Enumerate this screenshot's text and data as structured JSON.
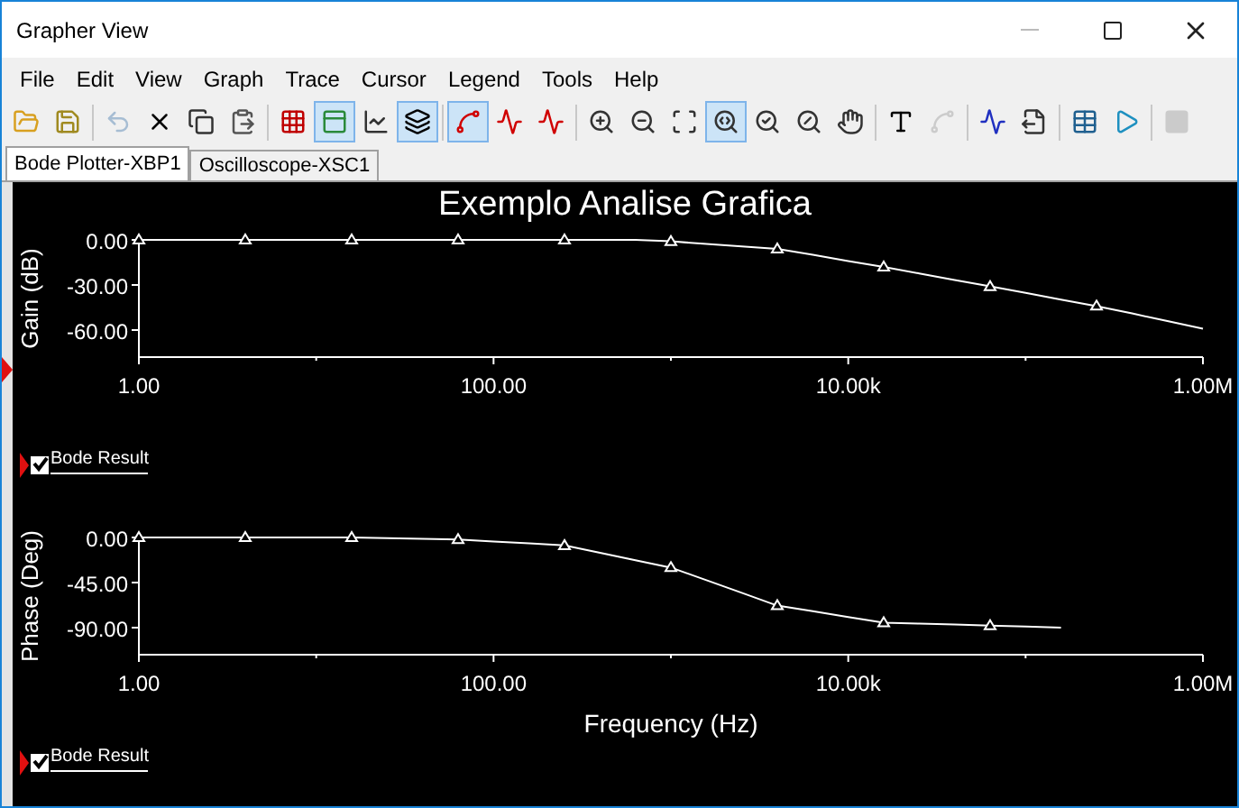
{
  "window": {
    "title": "Grapher View"
  },
  "menu": [
    "File",
    "Edit",
    "View",
    "Graph",
    "Trace",
    "Cursor",
    "Legend",
    "Tools",
    "Help"
  ],
  "toolbar": [
    [
      {
        "selected": false,
        "disabled": false
      },
      {
        "selected": false,
        "disabled": false
      }
    ],
    [
      {
        "selected": false,
        "disabled": true
      },
      {
        "selected": false,
        "disabled": false
      },
      {
        "selected": false,
        "disabled": false
      },
      {
        "selected": false,
        "disabled": false
      }
    ],
    [
      {
        "selected": false,
        "disabled": false
      },
      {
        "selected": true,
        "disabled": false
      },
      {
        "selected": false,
        "disabled": false
      },
      {
        "selected": true,
        "disabled": false
      }
    ],
    [
      {
        "selected": true,
        "disabled": false
      },
      {
        "selected": false,
        "disabled": false
      },
      {
        "selected": false,
        "disabled": false
      }
    ],
    [
      {
        "selected": false,
        "disabled": false
      },
      {
        "selected": false,
        "disabled": false
      },
      {
        "selected": false,
        "disabled": false
      },
      {
        "selected": true,
        "disabled": false
      },
      {
        "selected": false,
        "disabled": false
      },
      {
        "selected": false,
        "disabled": false
      },
      {
        "selected": false,
        "disabled": false
      }
    ],
    [
      {
        "selected": false,
        "disabled": false
      },
      {
        "selected": false,
        "disabled": true
      }
    ],
    [
      {
        "selected": false,
        "disabled": false
      },
      {
        "selected": false,
        "disabled": false
      }
    ],
    [
      {
        "selected": false,
        "disabled": false
      },
      {
        "selected": false,
        "disabled": false
      }
    ],
    [
      {
        "selected": false,
        "disabled": true
      }
    ]
  ],
  "tabs": [
    {
      "label": "Bode Plotter-XBP1",
      "selected": true
    },
    {
      "label": "Oscilloscope-XSC1",
      "selected": false
    }
  ],
  "graphs": [
    {
      "legend": {
        "checked": true
      },
      "chart_data": {
        "type": "line",
        "title": "Exemplo Analise Grafica",
        "ylabel": "Gain (dB)",
        "ylim": [
          -78,
          0
        ],
        "categories": [
          "1.00",
          null,
          null,
          null,
          null,
          null,
          null,
          null,
          null,
          null,
          "100.00",
          null,
          null,
          null,
          null,
          null,
          null,
          null,
          null,
          null,
          "10.00k",
          null,
          null,
          null,
          null,
          null,
          null,
          null,
          null,
          null,
          "1.00M"
        ],
        "yticks": [
          {
            "value": 0,
            "label": "0.00"
          },
          {
            "value": -30,
            "label": "-30.00"
          },
          {
            "value": -60,
            "label": "-60.00"
          }
        ],
        "series": [
          {
            "name": "Bode Result",
            "color": "#ffffff",
            "values": [
              0,
              0,
              0,
              0,
              0,
              0,
              0,
              0,
              0,
              0,
              0,
              0,
              0,
              0,
              0,
              -1,
              -2.7,
              -4.3,
              -6,
              -10,
              -14,
              -18,
              -22.3,
              -26.7,
              -31,
              -35.3,
              -39.7,
              -44,
              -49,
              -54,
              -59
            ]
          }
        ]
      }
    },
    {
      "legend": {
        "checked": true
      },
      "chart_data": {
        "type": "line",
        "xlabel": "Frequency (Hz)",
        "ylabel": "Phase (Deg)",
        "ylim": [
          -117,
          0
        ],
        "categories": [
          "1.00",
          null,
          null,
          null,
          null,
          null,
          null,
          null,
          null,
          null,
          "100.00",
          null,
          null,
          null,
          null,
          null,
          null,
          null,
          null,
          null,
          "10.00k",
          null,
          null,
          null,
          null,
          null,
          null,
          null,
          null,
          null,
          "1.00M"
        ],
        "yticks": [
          {
            "value": 0,
            "label": "0.00"
          },
          {
            "value": -45,
            "label": "-45.00"
          },
          {
            "value": -90,
            "label": "-90.00"
          }
        ],
        "series": [
          {
            "name": "Bode Result",
            "color": "#ffffff",
            "values": [
              0,
              0,
              0,
              0,
              0,
              0,
              0,
              -0.7,
              -1.3,
              -2,
              -4,
              -6,
              -8,
              -15.3,
              -22.7,
              -30,
              -42.7,
              -55.3,
              -68,
              -73.7,
              -79.3,
              -85,
              -86,
              -87,
              -88,
              -89,
              -90,
              null,
              null,
              null,
              null
            ]
          }
        ]
      }
    }
  ]
}
